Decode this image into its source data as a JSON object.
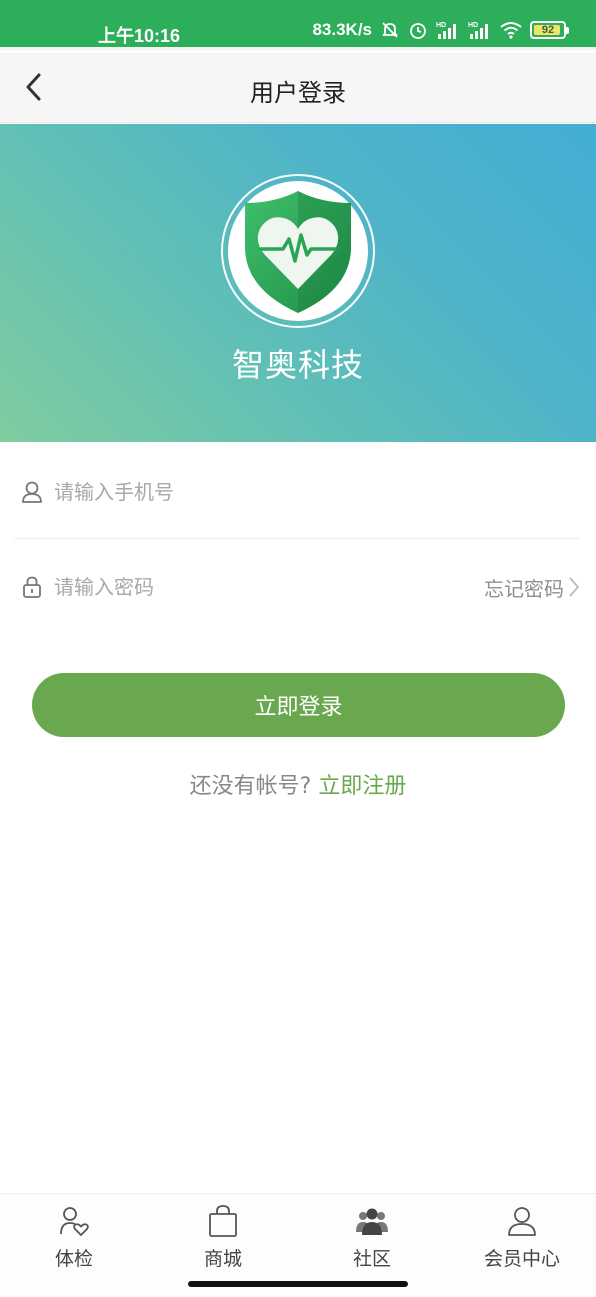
{
  "status_bar": {
    "time": "上午10:16",
    "network_speed": "83.3K/s",
    "battery": "92",
    "background_color": "#2dae5b",
    "icons": [
      "mute-bell-icon",
      "alarm-icon",
      "hd-signal-icon",
      "hd-signal-icon",
      "wifi-icon",
      "battery-icon"
    ]
  },
  "nav": {
    "title": "用户登录",
    "back_icon": "chevron-left-icon"
  },
  "hero": {
    "brand_name": "智奥科技",
    "logo_icon": "shield-heart-icon"
  },
  "form": {
    "phone_placeholder": "请输入手机号",
    "phone_value": "",
    "password_placeholder": "请输入密码",
    "password_value": "",
    "forgot_label": "忘记密码",
    "login_label": "立即登录",
    "no_account_text": "还没有帐号?",
    "register_label": "立即注册",
    "accent_color": "#6aa84f"
  },
  "tabs": [
    {
      "label": "体检",
      "icon": "heart-person-icon"
    },
    {
      "label": "商城",
      "icon": "shopping-bag-icon"
    },
    {
      "label": "社区",
      "icon": "community-icon"
    },
    {
      "label": "会员中心",
      "icon": "user-icon"
    }
  ]
}
